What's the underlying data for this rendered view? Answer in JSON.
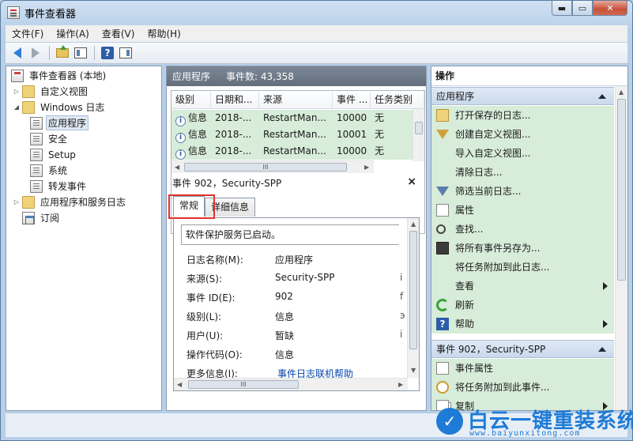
{
  "window": {
    "title": "事件查看器",
    "min_glyph": "▬",
    "max_glyph": "▭",
    "close_glyph": "✕"
  },
  "menu": [
    "文件(F)",
    "操作(A)",
    "查看(V)",
    "帮助(H)"
  ],
  "tree": {
    "root": "事件查看器 (本地)",
    "custom_views": "自定义视图",
    "windows_logs": "Windows 日志",
    "windows_logs_items": [
      "应用程序",
      "安全",
      "Setup",
      "系统",
      "转发事件"
    ],
    "app_service_logs": "应用程序和服务日志",
    "subscriptions": "订阅"
  },
  "events_pane": {
    "title": "应用程序",
    "count": "事件数: 43,358",
    "columns": [
      "级别",
      "日期和...",
      "来源",
      "事件 ...",
      "任务类别"
    ],
    "rows": [
      {
        "level": "信息",
        "date": "2018-...",
        "source": "RestartMan...",
        "event": "10000",
        "task": "无"
      },
      {
        "level": "信息",
        "date": "2018-...",
        "source": "RestartMan...",
        "event": "10001",
        "task": "无"
      },
      {
        "level": "信息",
        "date": "2018-...",
        "source": "RestartMan...",
        "event": "10000",
        "task": "无"
      }
    ],
    "hscroll_glyph": "III"
  },
  "detail": {
    "title": "事件 902，Security-SPP",
    "close": "×",
    "tabs": [
      "常规",
      "详细信息"
    ],
    "message": "软件保护服务已启动。",
    "props": [
      {
        "label": "日志名称(M):",
        "value": "应用程序",
        "cut": ""
      },
      {
        "label": "来源(S):",
        "value": "Security-SPP",
        "cut": "i"
      },
      {
        "label": "事件 ID(E):",
        "value": "902",
        "cut": "f"
      },
      {
        "label": "级别(L):",
        "value": "信息",
        "cut": "э"
      },
      {
        "label": "用户(U):",
        "value": "暂缺",
        "cut": "i"
      },
      {
        "label": "操作代码(O):",
        "value": "信息",
        "cut": ""
      },
      {
        "label": "更多信息(I):",
        "value": "事件日志联机帮助",
        "cut": ""
      }
    ],
    "hscroll_glyph": "III"
  },
  "actions": {
    "title": "操作",
    "section1": "应用程序",
    "items1": [
      {
        "label": "打开保存的日志...",
        "icon": "open-log-icon",
        "sub": false
      },
      {
        "label": "创建自定义视图...",
        "icon": "filter-icon",
        "sub": false
      },
      {
        "label": "导入自定义视图...",
        "icon": "",
        "sub": false
      },
      {
        "label": "清除日志...",
        "icon": "",
        "sub": false
      },
      {
        "label": "筛选当前日志...",
        "icon": "filter-icon",
        "sub": false
      },
      {
        "label": "属性",
        "icon": "properties-icon",
        "sub": false
      },
      {
        "label": "查找...",
        "icon": "find-icon",
        "sub": false
      },
      {
        "label": "将所有事件另存为...",
        "icon": "save-icon",
        "sub": false
      },
      {
        "label": "将任务附加到此日志...",
        "icon": "",
        "sub": false
      },
      {
        "label": "查看",
        "icon": "",
        "sub": true
      },
      {
        "label": "刷新",
        "icon": "refresh-icon",
        "sub": false
      },
      {
        "label": "帮助",
        "icon": "help-icon",
        "sub": true
      }
    ],
    "section2": "事件 902，Security-SPP",
    "items2": [
      {
        "label": "事件属性",
        "icon": "properties-icon",
        "sub": false
      },
      {
        "label": "将任务附加到此事件...",
        "icon": "task-icon",
        "sub": false
      },
      {
        "label": "复制",
        "icon": "copy-icon",
        "sub": true
      }
    ]
  },
  "watermark": {
    "bird": "✓",
    "text": "白云一键重装系统",
    "url": "www.baiyunxitong.com"
  }
}
